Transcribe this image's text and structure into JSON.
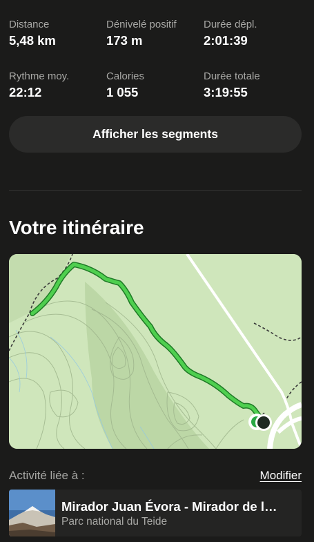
{
  "stats": [
    {
      "label": "Distance",
      "value": "5,48 km"
    },
    {
      "label": "Dénivelé positif",
      "value": "173 m"
    },
    {
      "label": "Durée dépl.",
      "value": "2:01:39"
    },
    {
      "label": "Rythme moy.",
      "value": "22:12"
    },
    {
      "label": "Calories",
      "value": "1 055"
    },
    {
      "label": "Durée totale",
      "value": "3:19:55"
    }
  ],
  "segments_button": "Afficher les segments",
  "route_section": {
    "title": "Votre itinéraire"
  },
  "map": {
    "route_color": "#4fcf4f",
    "terrain_color": "#cfe6bb",
    "icons": [
      "route-start-marker",
      "route-end-marker"
    ]
  },
  "linked_activity": {
    "label": "Activité liée à :",
    "modify_link": "Modifier",
    "title": "Mirador Juan Évora - Mirador de l…",
    "subtitle": "Parc national du Teide"
  }
}
